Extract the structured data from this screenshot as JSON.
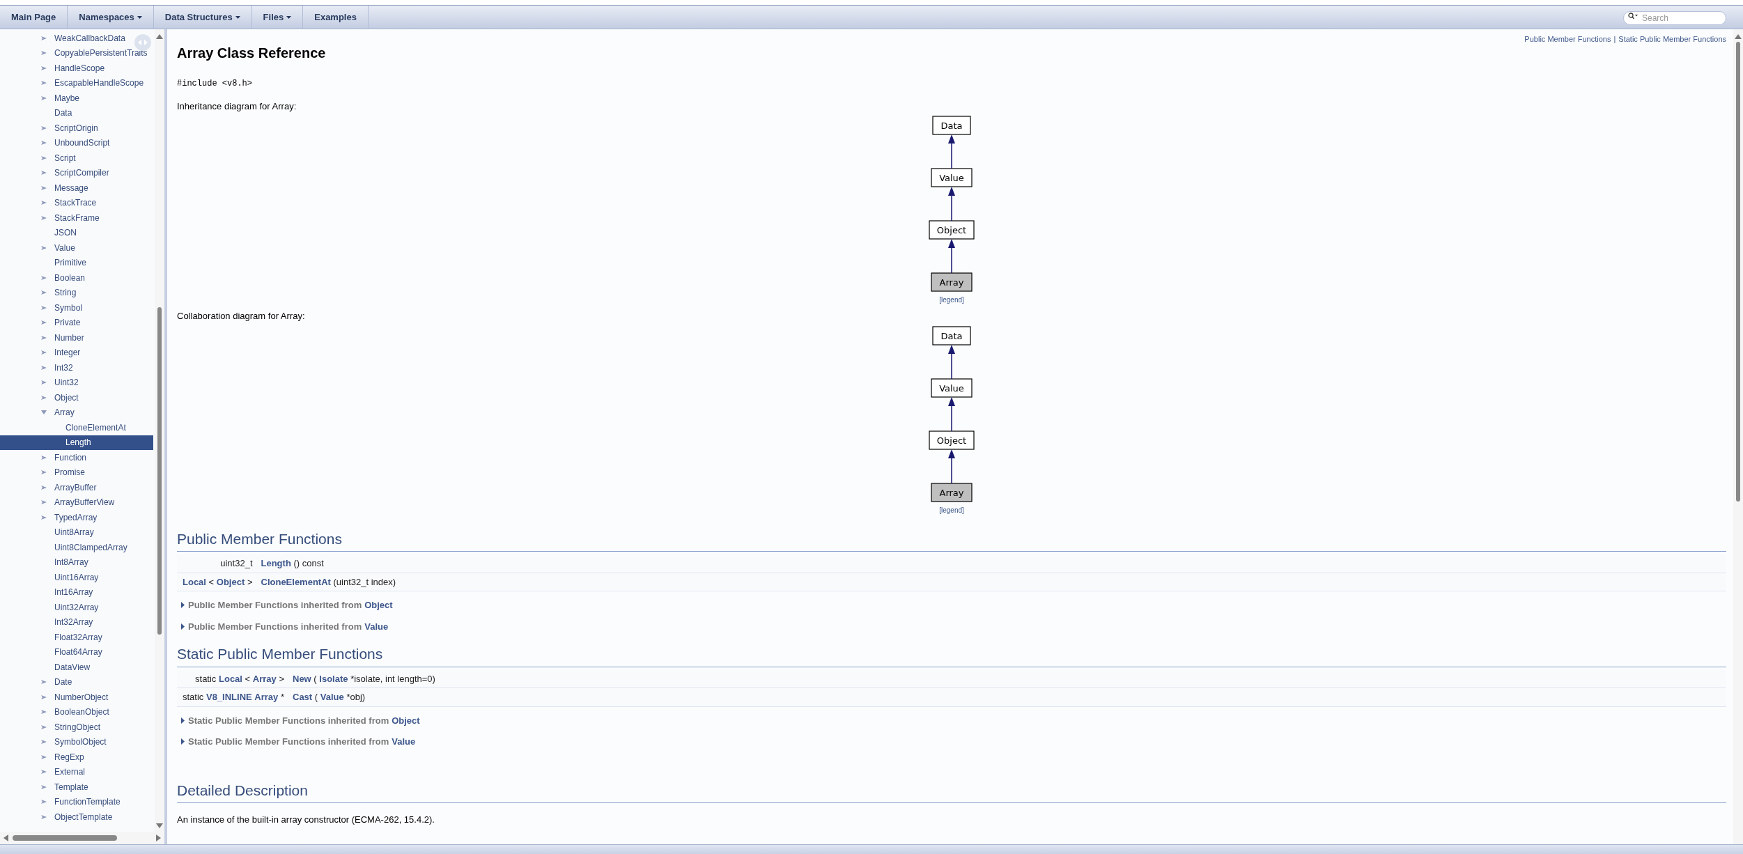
{
  "nav": {
    "items": [
      {
        "label": "Main Page",
        "dropdown": false
      },
      {
        "label": "Namespaces",
        "dropdown": true
      },
      {
        "label": "Data Structures",
        "dropdown": true
      },
      {
        "label": "Files",
        "dropdown": true
      },
      {
        "label": "Examples",
        "dropdown": false
      }
    ],
    "search": {
      "placeholder": "Search"
    }
  },
  "sidebar": {
    "items": [
      {
        "label": "WeakCallbackData",
        "kind": "collapsed",
        "selected": false
      },
      {
        "label": "CopyablePersistentTraits",
        "kind": "collapsed",
        "selected": false
      },
      {
        "label": "HandleScope",
        "kind": "collapsed",
        "selected": false
      },
      {
        "label": "EscapableHandleScope",
        "kind": "collapsed",
        "selected": false
      },
      {
        "label": "Maybe",
        "kind": "collapsed",
        "selected": false
      },
      {
        "label": "Data",
        "kind": "leaf",
        "selected": false
      },
      {
        "label": "ScriptOrigin",
        "kind": "collapsed",
        "selected": false
      },
      {
        "label": "UnboundScript",
        "kind": "collapsed",
        "selected": false
      },
      {
        "label": "Script",
        "kind": "collapsed",
        "selected": false
      },
      {
        "label": "ScriptCompiler",
        "kind": "collapsed",
        "selected": false
      },
      {
        "label": "Message",
        "kind": "collapsed",
        "selected": false
      },
      {
        "label": "StackTrace",
        "kind": "collapsed",
        "selected": false
      },
      {
        "label": "StackFrame",
        "kind": "collapsed",
        "selected": false
      },
      {
        "label": "JSON",
        "kind": "leaf",
        "selected": false
      },
      {
        "label": "Value",
        "kind": "collapsed",
        "selected": false
      },
      {
        "label": "Primitive",
        "kind": "leaf",
        "selected": false
      },
      {
        "label": "Boolean",
        "kind": "collapsed",
        "selected": false
      },
      {
        "label": "String",
        "kind": "collapsed",
        "selected": false
      },
      {
        "label": "Symbol",
        "kind": "collapsed",
        "selected": false
      },
      {
        "label": "Private",
        "kind": "collapsed",
        "selected": false
      },
      {
        "label": "Number",
        "kind": "collapsed",
        "selected": false
      },
      {
        "label": "Integer",
        "kind": "collapsed",
        "selected": false
      },
      {
        "label": "Int32",
        "kind": "collapsed",
        "selected": false
      },
      {
        "label": "Uint32",
        "kind": "collapsed",
        "selected": false
      },
      {
        "label": "Object",
        "kind": "collapsed",
        "selected": false
      },
      {
        "label": "Array",
        "kind": "expanded",
        "selected": false,
        "children": [
          {
            "label": "CloneElementAt",
            "selected": false
          },
          {
            "label": "Length",
            "selected": true
          }
        ]
      },
      {
        "label": "Function",
        "kind": "collapsed",
        "selected": false
      },
      {
        "label": "Promise",
        "kind": "collapsed",
        "selected": false
      },
      {
        "label": "ArrayBuffer",
        "kind": "collapsed",
        "selected": false
      },
      {
        "label": "ArrayBufferView",
        "kind": "collapsed",
        "selected": false
      },
      {
        "label": "TypedArray",
        "kind": "collapsed",
        "selected": false
      },
      {
        "label": "Uint8Array",
        "kind": "leaf",
        "selected": false
      },
      {
        "label": "Uint8ClampedArray",
        "kind": "leaf",
        "selected": false
      },
      {
        "label": "Int8Array",
        "kind": "leaf",
        "selected": false
      },
      {
        "label": "Uint16Array",
        "kind": "leaf",
        "selected": false
      },
      {
        "label": "Int16Array",
        "kind": "leaf",
        "selected": false
      },
      {
        "label": "Uint32Array",
        "kind": "leaf",
        "selected": false
      },
      {
        "label": "Int32Array",
        "kind": "leaf",
        "selected": false
      },
      {
        "label": "Float32Array",
        "kind": "leaf",
        "selected": false
      },
      {
        "label": "Float64Array",
        "kind": "leaf",
        "selected": false
      },
      {
        "label": "DataView",
        "kind": "leaf",
        "selected": false
      },
      {
        "label": "Date",
        "kind": "collapsed",
        "selected": false
      },
      {
        "label": "NumberObject",
        "kind": "collapsed",
        "selected": false
      },
      {
        "label": "BooleanObject",
        "kind": "collapsed",
        "selected": false
      },
      {
        "label": "StringObject",
        "kind": "collapsed",
        "selected": false
      },
      {
        "label": "SymbolObject",
        "kind": "collapsed",
        "selected": false
      },
      {
        "label": "RegExp",
        "kind": "collapsed",
        "selected": false
      },
      {
        "label": "External",
        "kind": "collapsed",
        "selected": false
      },
      {
        "label": "Template",
        "kind": "collapsed",
        "selected": false
      },
      {
        "label": "FunctionTemplate",
        "kind": "collapsed",
        "selected": false
      },
      {
        "label": "ObjectTemplate",
        "kind": "collapsed",
        "selected": false
      }
    ]
  },
  "content": {
    "summary_links": [
      "Public Member Functions",
      "Static Public Member Functions"
    ],
    "summary_separator": "|",
    "title": "Array Class Reference",
    "include": "#include <v8.h>",
    "diagrams": [
      {
        "label": "Inheritance diagram for Array:",
        "nodes": [
          {
            "label": "Data",
            "highlighted": false
          },
          {
            "label": "Value",
            "highlighted": false
          },
          {
            "label": "Object",
            "highlighted": false
          },
          {
            "label": "Array",
            "highlighted": true
          }
        ],
        "legend": "[legend]"
      },
      {
        "label": "Collaboration diagram for Array:",
        "nodes": [
          {
            "label": "Data",
            "highlighted": false
          },
          {
            "label": "Value",
            "highlighted": false
          },
          {
            "label": "Object",
            "highlighted": false
          },
          {
            "label": "Array",
            "highlighted": true
          }
        ],
        "legend": "[legend]"
      }
    ],
    "sections": [
      {
        "heading": "Public Member Functions",
        "rows": [
          {
            "type": [
              {
                "text": "uint32_t",
                "link": false
              }
            ],
            "name": [
              {
                "text": "Length",
                "link": true
              },
              {
                "text": "() const",
                "link": false
              }
            ]
          },
          {
            "type": [
              {
                "text": "Local",
                "link": true
              },
              {
                "text": "< ",
                "link": false
              },
              {
                "text": "Object",
                "link": true
              },
              {
                "text": " >",
                "link": false
              }
            ],
            "name": [
              {
                "text": "CloneElementAt",
                "link": true
              },
              {
                "text": "(uint32_t index)",
                "link": false
              }
            ]
          }
        ],
        "inherited": [
          {
            "label": "Public Member Functions inherited from",
            "link": "Object",
            "expanded": false
          },
          {
            "label": "Public Member Functions inherited from",
            "link": "Value",
            "expanded": false
          }
        ]
      },
      {
        "heading": "Static Public Member Functions",
        "rows": [
          {
            "type": [
              {
                "text": "static",
                "link": false
              },
              {
                "text": "Local",
                "link": true
              },
              {
                "text": "< ",
                "link": false
              },
              {
                "text": "Array",
                "link": true
              },
              {
                "text": " >",
                "link": false
              }
            ],
            "name": [
              {
                "text": "New",
                "link": true
              },
              {
                "text": "(",
                "link": false
              },
              {
                "text": "Isolate",
                "link": true
              },
              {
                "text": "*isolate, int length=0)",
                "link": false
              }
            ]
          },
          {
            "type": [
              {
                "text": "static",
                "link": false
              },
              {
                "text": "V8_INLINE",
                "link": true
              },
              {
                "text": "Array",
                "link": true
              },
              {
                "text": "*",
                "link": false
              }
            ],
            "name": [
              {
                "text": "Cast",
                "link": true
              },
              {
                "text": "(",
                "link": false
              },
              {
                "text": "Value",
                "link": true
              },
              {
                "text": "*obj)",
                "link": false
              }
            ]
          }
        ],
        "inherited": [
          {
            "label": "Static Public Member Functions inherited from",
            "link": "Object",
            "expanded": false
          },
          {
            "label": "Static Public Member Functions inherited from",
            "link": "Value",
            "expanded": false
          }
        ]
      }
    ],
    "detail": {
      "heading": "Detailed Description",
      "text": "An instance of the built-in array constructor (ECMA-262, 15.4.2)."
    }
  }
}
